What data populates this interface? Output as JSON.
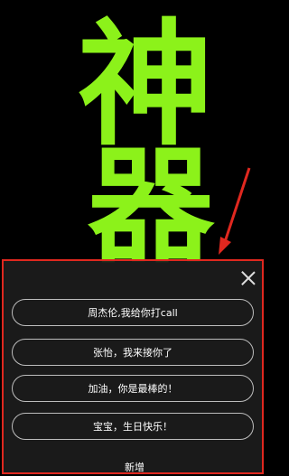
{
  "background_text": {
    "chars": [
      "神",
      "器"
    ],
    "color": "#8cf21a"
  },
  "sheet": {
    "options": [
      "周杰伦,我给你打call",
      "张怡，我来接你了",
      "加油，你是最棒的！",
      "宝宝，生日快乐！"
    ],
    "add_label": "新增",
    "border_color": "#e0281f"
  }
}
